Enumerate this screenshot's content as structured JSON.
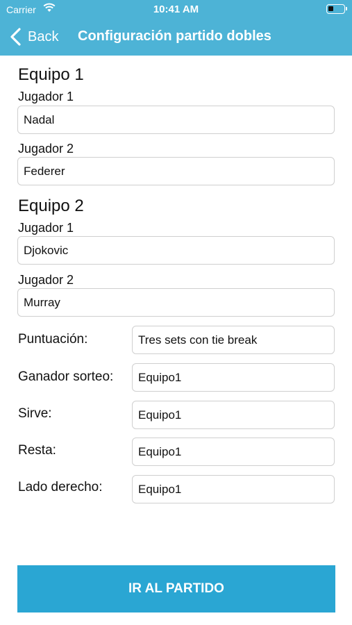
{
  "status_bar": {
    "carrier": "Carrier",
    "time": "10:41 AM",
    "battery_level": 0.35
  },
  "nav": {
    "back_label": "Back",
    "title": "Configuración partido dobles"
  },
  "team1": {
    "title": "Equipo 1",
    "player1": {
      "label": "Jugador 1",
      "value": "Nadal"
    },
    "player2": {
      "label": "Jugador 2",
      "value": "Federer"
    }
  },
  "team2": {
    "title": "Equipo 2",
    "player1": {
      "label": "Jugador 1",
      "value": "Djokovic"
    },
    "player2": {
      "label": "Jugador 2",
      "value": "Murray"
    }
  },
  "settings": {
    "scoring": {
      "label": "Puntuación:",
      "value": "Tres sets con tie break"
    },
    "toss_winner": {
      "label": "Ganador sorteo:",
      "value": "Equipo1"
    },
    "serves": {
      "label": "Sirve:",
      "value": "Equipo1"
    },
    "returns": {
      "label": "Resta:",
      "value": "Equipo1"
    },
    "right_side": {
      "label": "Lado derecho:",
      "value": "Equipo1"
    }
  },
  "go_button": {
    "label": "IR AL PARTIDO"
  },
  "colors": {
    "header": "#4db3d6",
    "button": "#2aa6d3"
  }
}
